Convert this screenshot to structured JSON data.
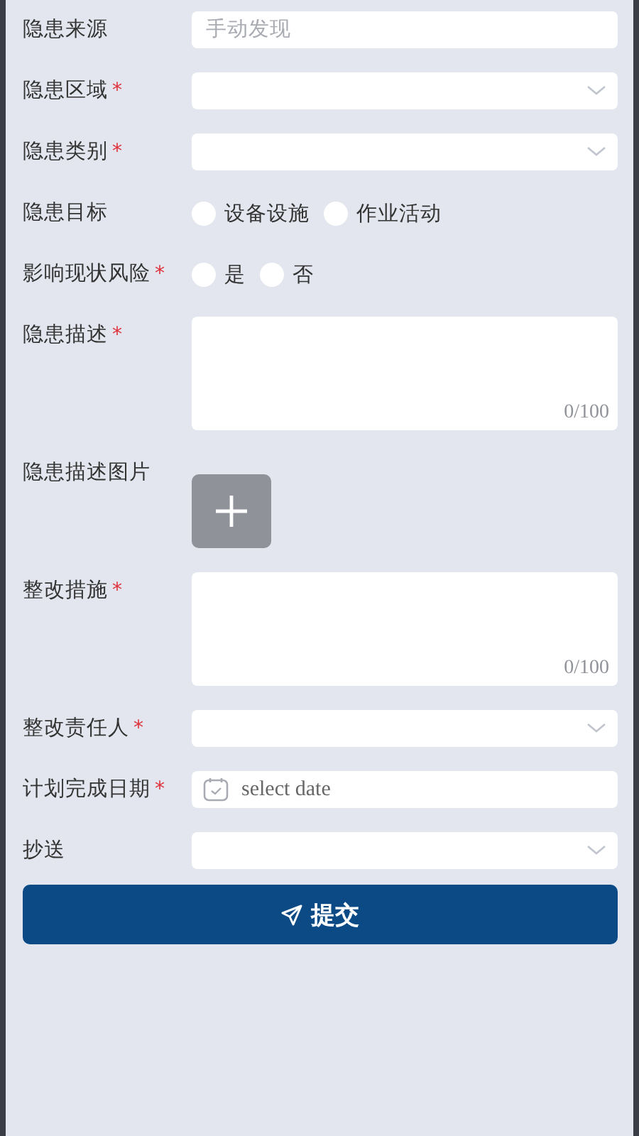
{
  "form": {
    "fields": [
      {
        "kind": "text",
        "label": "隐患来源",
        "placeholder": "手动发现"
      },
      {
        "kind": "select",
        "label": "隐患区域",
        "required_mark": "*"
      },
      {
        "kind": "select",
        "label": "隐患类别",
        "required_mark": "*"
      },
      {
        "kind": "radio",
        "label": "隐患目标",
        "options": [
          {
            "label": "设备设施",
            "selected": false
          },
          {
            "label": "作业活动",
            "selected": false
          }
        ]
      },
      {
        "kind": "radio",
        "label": "影响现状风险",
        "required_mark": "*",
        "options": [
          {
            "label": "是",
            "selected": false
          },
          {
            "label": "否",
            "selected": false
          }
        ]
      },
      {
        "kind": "textarea",
        "label": "隐患描述",
        "required_mark": "*",
        "counter": "0/100"
      },
      {
        "kind": "upload",
        "label": "隐患描述图片"
      },
      {
        "kind": "textarea",
        "label": "整改措施",
        "required_mark": "*",
        "counter": "0/100"
      },
      {
        "kind": "select",
        "label": "整改责任人",
        "required_mark": "*"
      },
      {
        "kind": "date",
        "label": "计划完成日期",
        "required_mark": "*",
        "placeholder": "select date"
      },
      {
        "kind": "select",
        "label": "抄送"
      }
    ],
    "submit": {
      "label": "提交"
    }
  }
}
